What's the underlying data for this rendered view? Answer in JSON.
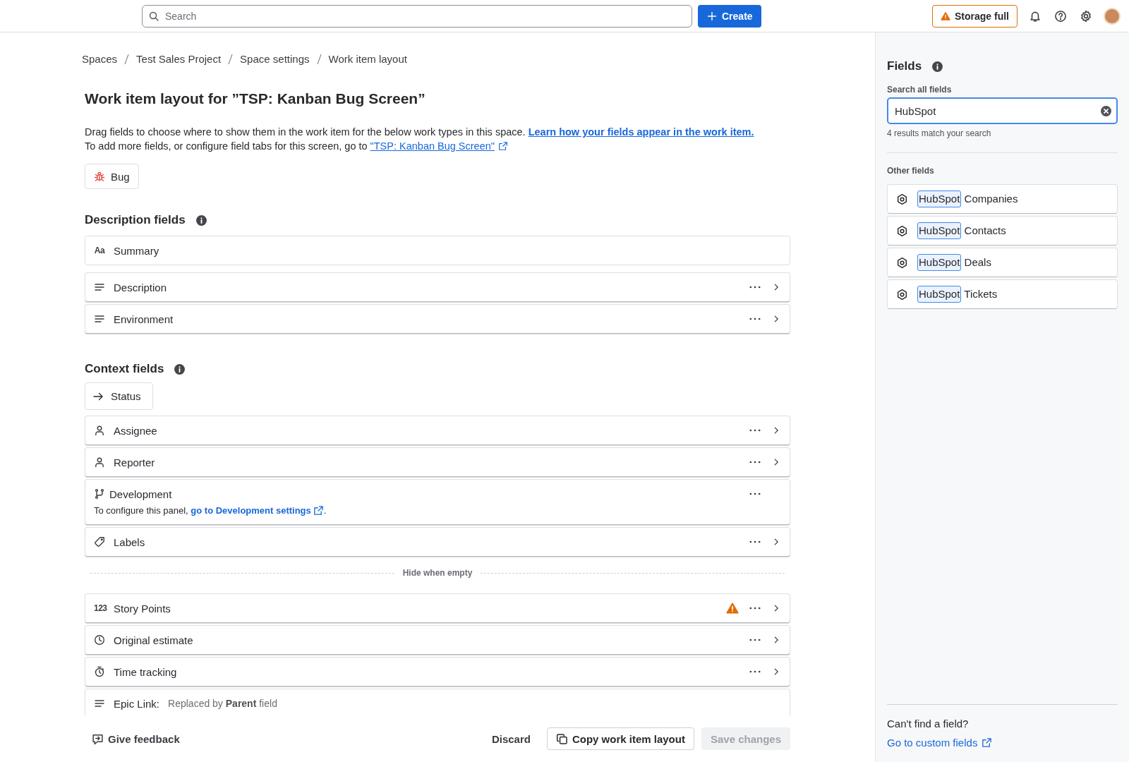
{
  "top_bar": {
    "search": {
      "placeholder": "Search"
    },
    "create_button": "Create",
    "storage_button": "Storage full"
  },
  "breadcrumbs": [
    "Spaces",
    "Test Sales Project",
    "Space settings",
    "Work item layout"
  ],
  "title": "Work item layout for ”TSP: Kanban Bug Screen”",
  "intro": {
    "line1": "Drag fields to choose where to show them in the work item for the below work types in this space.",
    "link1": "Learn how your fields appear in the work item.",
    "line2": "To add more fields, or configure field tabs for this screen, go to",
    "link2": "\"TSP: Kanban Bug Screen\""
  },
  "work_types": [
    {
      "label": "Bug"
    }
  ],
  "description_fields": {
    "heading": "Description fields",
    "rows": [
      {
        "kind": "text",
        "glyph": "Aa",
        "label": "Summary",
        "locked": true,
        "expandable": false
      },
      {
        "kind": "paragraph",
        "label": "Description",
        "locked": false,
        "expandable": true
      },
      {
        "kind": "paragraph",
        "label": "Environment",
        "locked": false,
        "expandable": true
      }
    ]
  },
  "context_fields": {
    "heading": "Context fields",
    "pinned": {
      "kind": "status",
      "label": "Status"
    },
    "rows": [
      {
        "kind": "user",
        "label": "Assignee",
        "locked": false,
        "expandable": true
      },
      {
        "kind": "user",
        "label": "Reporter",
        "locked": false,
        "expandable": true
      },
      {
        "kind": "development",
        "label": "Development",
        "locked": false,
        "expandable": false,
        "note_before": "To configure this panel,",
        "note_link": "go to Development settings",
        "note_after": "."
      },
      {
        "kind": "label",
        "label": "Labels",
        "locked": false,
        "expandable": true
      }
    ],
    "divider": "Hide when empty",
    "hidden_rows": [
      {
        "kind": "number",
        "glyph": "123",
        "label": "Story Points",
        "locked": false,
        "expandable": true,
        "warning": true
      },
      {
        "kind": "time",
        "label": "Original estimate",
        "locked": false,
        "expandable": true
      },
      {
        "kind": "timer",
        "label": "Time tracking",
        "locked": false,
        "expandable": true
      },
      {
        "kind": "paragraph",
        "label": "Epic Link:",
        "locked": true,
        "expandable": false,
        "note": "Replaced by **Parent** field"
      }
    ]
  },
  "footer": {
    "feedback": "Give feedback",
    "discard": "Discard",
    "copy": "Copy work item layout",
    "save": {
      "label": "Save changes",
      "disabled": true
    }
  },
  "fields_panel": {
    "title": "Fields",
    "search_label": "Search all fields",
    "search_value": "HubSpot",
    "result_count": "4 results match your search",
    "section": "Other fields",
    "items": [
      {
        "match": "HubSpot",
        "rest": "Companies"
      },
      {
        "match": "HubSpot",
        "rest": "Contacts"
      },
      {
        "match": "HubSpot",
        "rest": "Deals"
      },
      {
        "match": "HubSpot",
        "rest": "Tickets"
      }
    ],
    "help_title": "Can't find a field?",
    "help_link": "Go to custom fields"
  }
}
